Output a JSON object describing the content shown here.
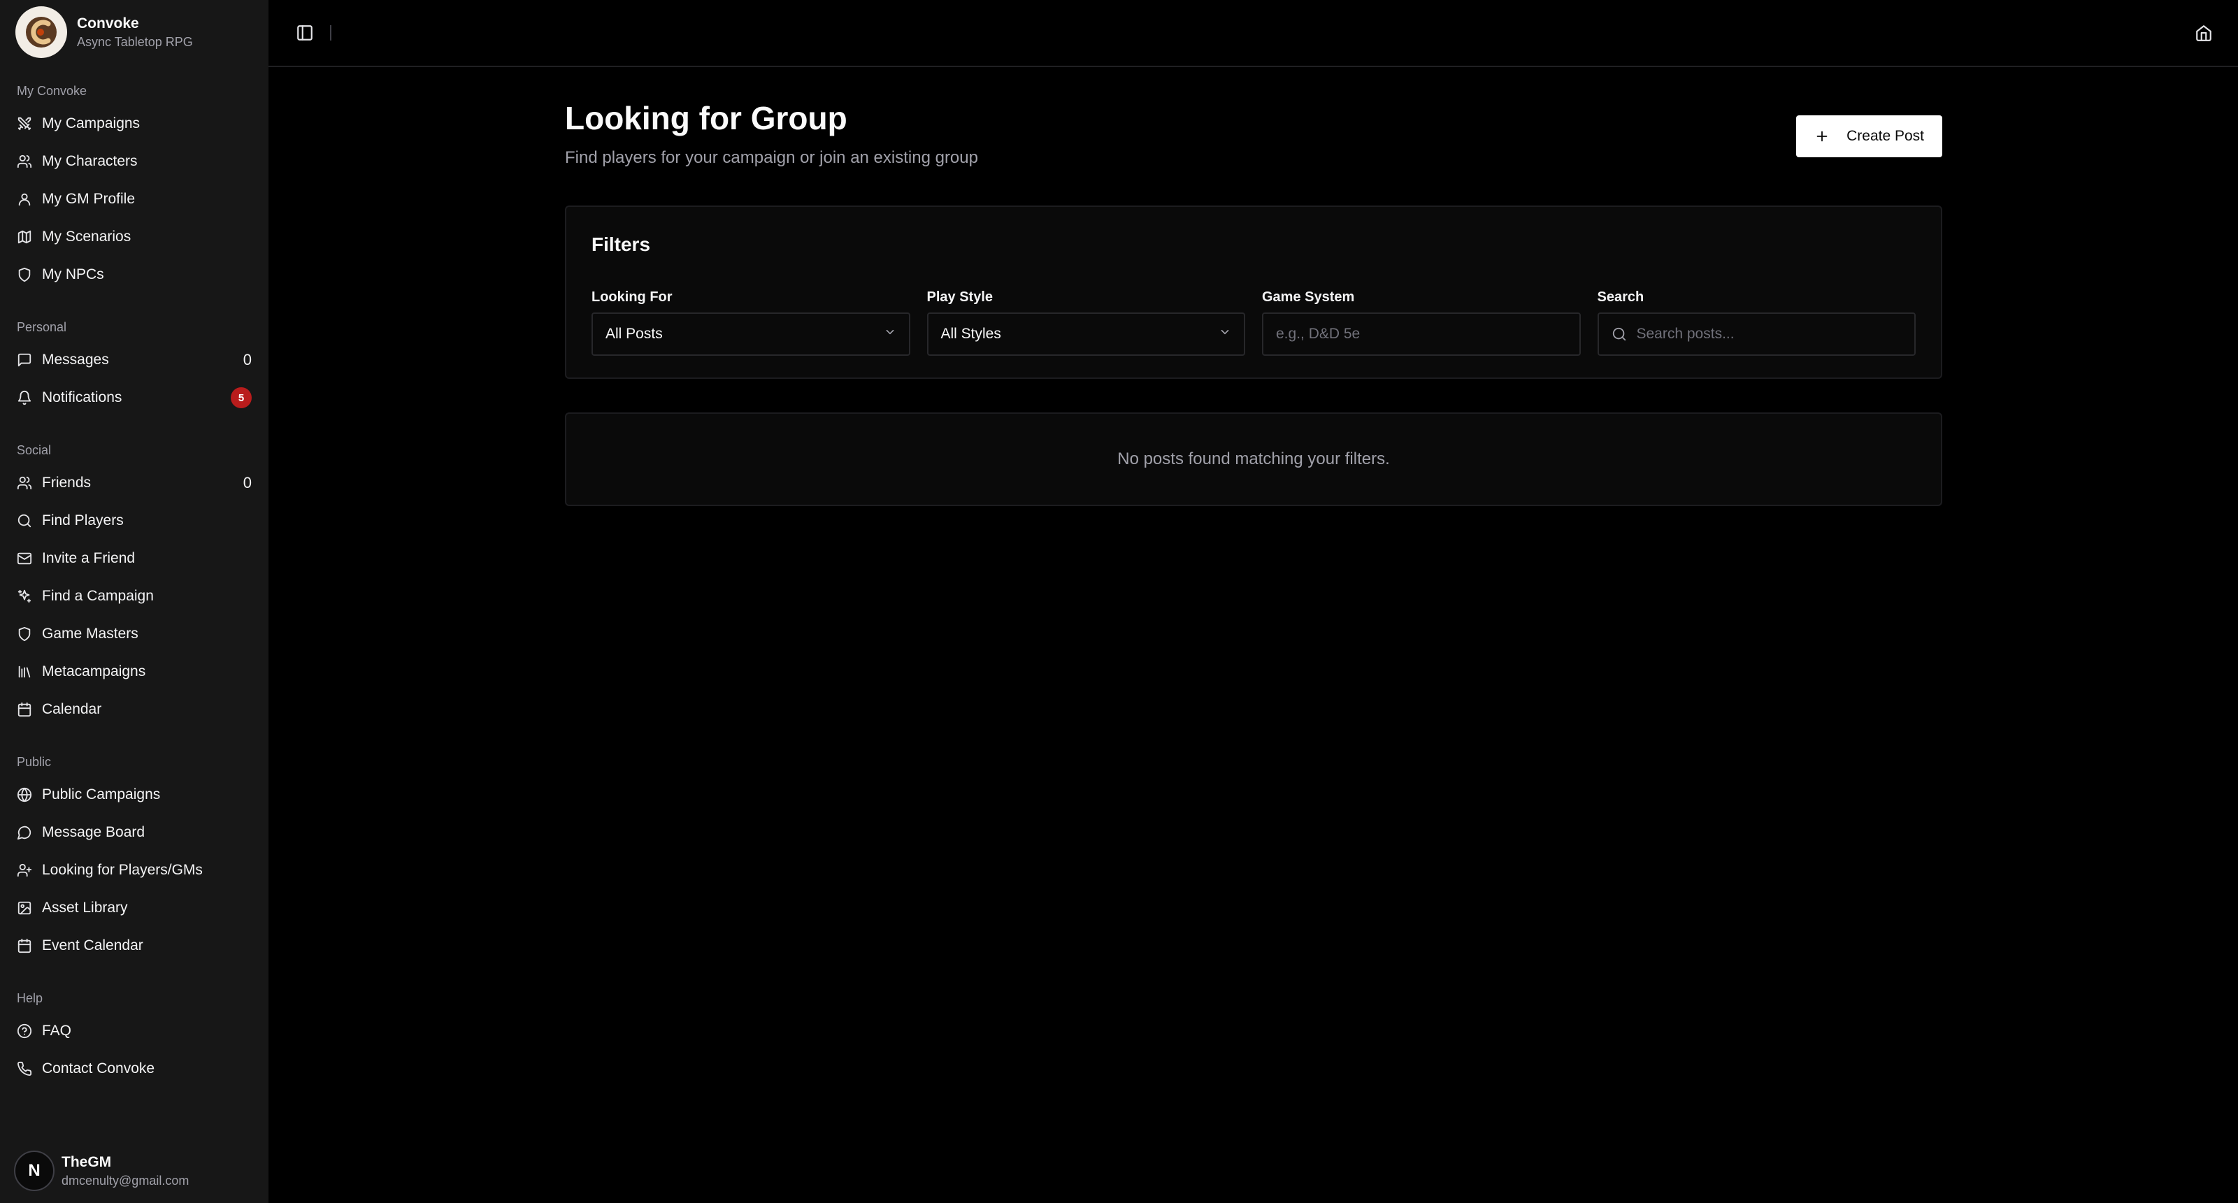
{
  "app": {
    "name": "Convoke",
    "subtitle": "Async Tabletop RPG"
  },
  "sidebar": {
    "groups": [
      {
        "label": "My Convoke",
        "items": [
          {
            "label": "My Campaigns",
            "icon": "swords-icon"
          },
          {
            "label": "My Characters",
            "icon": "users-icon"
          },
          {
            "label": "My GM Profile",
            "icon": "user-icon"
          },
          {
            "label": "My Scenarios",
            "icon": "map-icon"
          },
          {
            "label": "My NPCs",
            "icon": "shield-icon"
          }
        ]
      },
      {
        "label": "Personal",
        "items": [
          {
            "label": "Messages",
            "icon": "message-square-icon",
            "count": "0"
          },
          {
            "label": "Notifications",
            "icon": "bell-icon",
            "badge": "5"
          }
        ]
      },
      {
        "label": "Social",
        "items": [
          {
            "label": "Friends",
            "icon": "users-icon",
            "count": "0"
          },
          {
            "label": "Find Players",
            "icon": "search-icon"
          },
          {
            "label": "Invite a Friend",
            "icon": "mail-icon"
          },
          {
            "label": "Find a Campaign",
            "icon": "sparkles-icon"
          },
          {
            "label": "Game Masters",
            "icon": "shield-icon"
          },
          {
            "label": "Metacampaigns",
            "icon": "library-icon"
          },
          {
            "label": "Calendar",
            "icon": "calendar-icon"
          }
        ]
      },
      {
        "label": "Public",
        "items": [
          {
            "label": "Public Campaigns",
            "icon": "globe-icon"
          },
          {
            "label": "Message Board",
            "icon": "message-circle-icon"
          },
          {
            "label": "Looking for Players/GMs",
            "icon": "user-plus-icon"
          },
          {
            "label": "Asset Library",
            "icon": "image-icon"
          },
          {
            "label": "Event Calendar",
            "icon": "calendar-icon"
          }
        ]
      },
      {
        "label": "Help",
        "items": [
          {
            "label": "FAQ",
            "icon": "help-circle-icon"
          },
          {
            "label": "Contact Convoke",
            "icon": "phone-icon"
          }
        ]
      }
    ]
  },
  "user": {
    "initial": "N",
    "name": "TheGM",
    "email": "dmcenulty@gmail.com"
  },
  "topbar": {
    "toggle_icon": "sidebar-toggle-icon",
    "home_icon": "home-icon"
  },
  "page": {
    "title": "Looking for Group",
    "subtitle": "Find players for your campaign or join an existing group",
    "create_label": "Create Post"
  },
  "filters": {
    "title": "Filters",
    "looking_for": {
      "label": "Looking For",
      "value": "All Posts"
    },
    "play_style": {
      "label": "Play Style",
      "value": "All Styles"
    },
    "game_system": {
      "label": "Game System",
      "placeholder": "e.g., D&D 5e"
    },
    "search": {
      "label": "Search",
      "placeholder": "Search posts..."
    }
  },
  "empty_state": "No posts found matching your filters.",
  "colors": {
    "background": "#000000",
    "sidebar": "#171717",
    "badge": "#b91c1c",
    "primary_button": "#ffffff"
  }
}
